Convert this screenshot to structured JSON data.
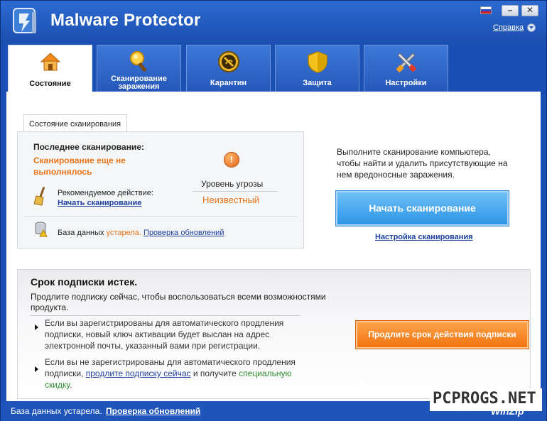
{
  "app": {
    "title": "Malware Protector",
    "help_label": "Справка",
    "minimize": "–",
    "close": "✕"
  },
  "tabs": [
    {
      "label": "Состояние",
      "icon": "home-icon"
    },
    {
      "label": "Сканирование заражения",
      "icon": "magnifier-icon"
    },
    {
      "label": "Карантин",
      "icon": "quarantine-icon"
    },
    {
      "label": "Защита",
      "icon": "shield-icon"
    },
    {
      "label": "Настройки",
      "icon": "tools-icon"
    }
  ],
  "scan_status": {
    "tab_label": "Состояние сканирования",
    "last_scan_title": "Последнее сканирование:",
    "last_scan_value": "Сканирование еще не выполнялось",
    "threat_label": "Уровень угрозы",
    "threat_value": "Неизвестный",
    "recommended_label": "Рекомендуемое действие:",
    "recommended_link": "Начать сканирование",
    "db_label": "База данных",
    "db_status": "устарела.",
    "db_link": "Проверка обновлений"
  },
  "right_panel": {
    "description": "Выполните сканирование компьютера, чтобы найти и удалить присутствующие на нем вредоносные заражения.",
    "start_button": "Начать сканирование",
    "settings_link": "Настройка сканирования"
  },
  "subscription": {
    "title": "Срок подписки истек.",
    "description": "Продлите подписку сейчас, чтобы воспользоваться всеми возможностями продукта.",
    "bullet1": "Если вы зарегистрированы для автоматического продления подписки, новый ключ активации будет выслан на адрес электронной почты, указанный вами при регистрации.",
    "bullet2_a": "Если вы не зарегистрированы для автоматического продления подписки, ",
    "bullet2_link": "продлите подписку сейчас",
    "bullet2_b": " и получите ",
    "bullet2_green": "специальную скидку",
    "bullet2_end": ".",
    "renew_button": "Продлите срок действия подписки"
  },
  "statusbar": {
    "text": "База данных устарела.",
    "link": "Проверка обновлений"
  },
  "watermark": {
    "site": "PCPROGS.NET",
    "brand": "WinZip"
  },
  "colors": {
    "frame_blue": "#1a4fb4",
    "orange": "#e8731a",
    "link_blue": "#1e3fa0",
    "start_button": "#2e95e6",
    "renew_button": "#f27411"
  }
}
